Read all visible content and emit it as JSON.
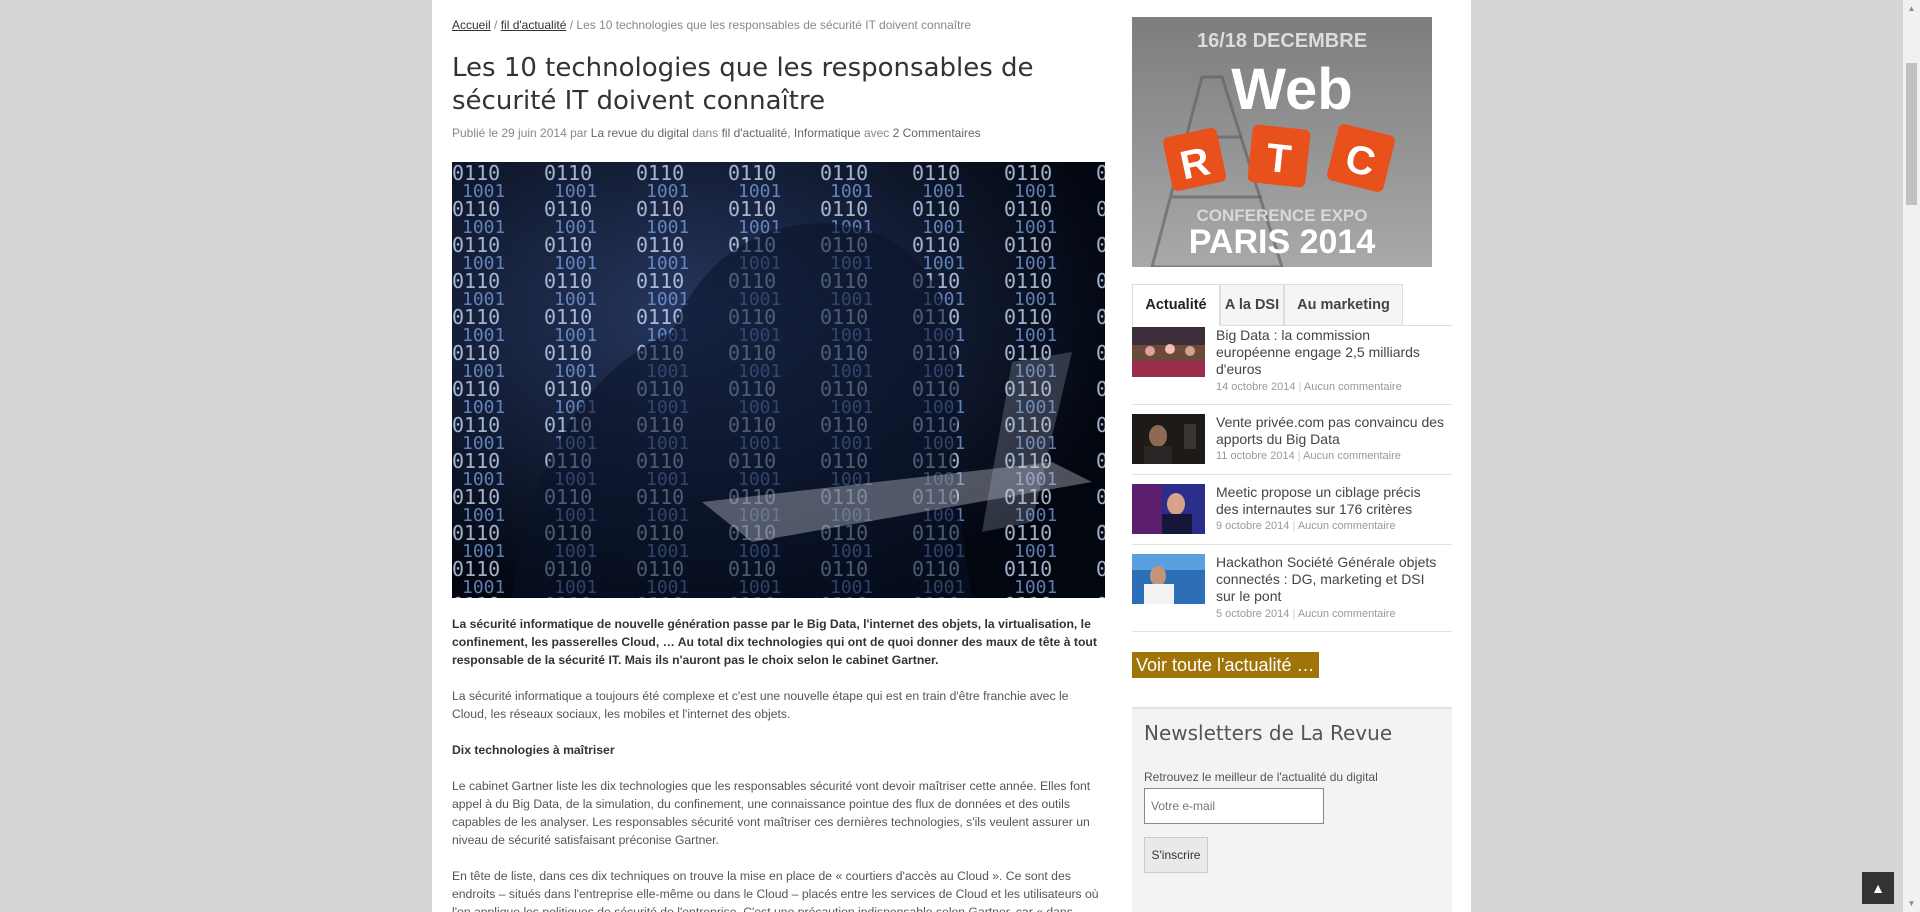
{
  "breadcrumb": {
    "home": "Accueil",
    "sep1": " / ",
    "category": "fil d'actualité",
    "sep2": " / ",
    "current": "Les 10 technologies que les responsables de sécurité IT doivent connaître"
  },
  "article": {
    "title": "Les 10 technologies que les responsables de sécurité IT doivent connaître",
    "meta_prefix": "Publié le 29 juin 2014 par ",
    "author": "La revue du digital",
    "meta_in": " dans ",
    "cat1": "fil d'actualité",
    "meta_comma": ", ",
    "cat2": "Informatique",
    "meta_with": " avec ",
    "comments": "2 Commentaires",
    "lead": "La sécurité informatique de nouvelle génération passe par le Big Data, l'internet des objets, la virtualisation, le confinement, les passerelles Cloud, … Au total dix technologies qui ont de quoi donner des maux de tête à tout responsable de la sécurité IT. Mais ils n'auront pas le choix selon le cabinet Gartner.",
    "p1": "La sécurité informatique a toujours été complexe et c'est une nouvelle étape qui est en train d'être franchie avec le Cloud, les réseaux sociaux, les mobiles et l'internet des objets.",
    "subhead": "Dix technologies à maîtriser",
    "p2": "Le cabinet Gartner liste les dix technologies que les responsables sécurité vont devoir maîtriser cette année. Elles font appel à du Big Data, de la simulation, du confinement, une connaissance pointue des flux de données et des outils capables de les analyser. Les responsables sécurité vont maîtriser ces dernières technologies, s'ils veulent assurer un niveau de sécurité satisfaisant préconise Gartner.",
    "p3": "En tête de liste, dans ces dix techniques on trouve la mise en place de « courtiers d'accès au Cloud ». Ce sont des endroits – situés dans l'entreprise elle-même ou dans le Cloud – placés entre les services de Cloud et les utilisateurs où l'on applique les politiques de sécurité de l'entreprise. C'est une précaution indispensable selon Gartner, car « dans"
  },
  "ad": {
    "dates": "16/18 DECEMBRE",
    "brand": "Web",
    "letters": [
      "R",
      "T",
      "C"
    ],
    "subtitle": "CONFERENCE EXPO",
    "city": "PARIS 2014"
  },
  "tabs": [
    "Actualité",
    "A la DSI",
    "Au marketing"
  ],
  "news": [
    {
      "title": "Big Data : la commission européenne engage 2,5 milliards d'euros",
      "date": "14 octobre 2014",
      "comments": "Aucun commentaire"
    },
    {
      "title": "Vente privée.com pas convaincu des apports du Big Data",
      "date": "11 octobre 2014",
      "comments": "Aucun commentaire"
    },
    {
      "title": "Meetic propose un ciblage précis des internautes sur 176 critères",
      "date": "9 octobre 2014",
      "comments": "Aucun commentaire"
    },
    {
      "title": "Hackathon Société Générale objets connectés : DG, marketing et DSI sur le pont",
      "date": "5 octobre 2014",
      "comments": "Aucun commentaire"
    }
  ],
  "news_meta_sep": "|",
  "voir_label": "Voir toute l'actualité …",
  "newsletter": {
    "title": "Newsletters de La Revue",
    "desc": "Retrouvez le meilleur de l'actualité du digital",
    "placeholder": "Votre e-mail",
    "button": "S'inscrire"
  },
  "icons": {
    "to_top": "chevron-up-icon"
  }
}
